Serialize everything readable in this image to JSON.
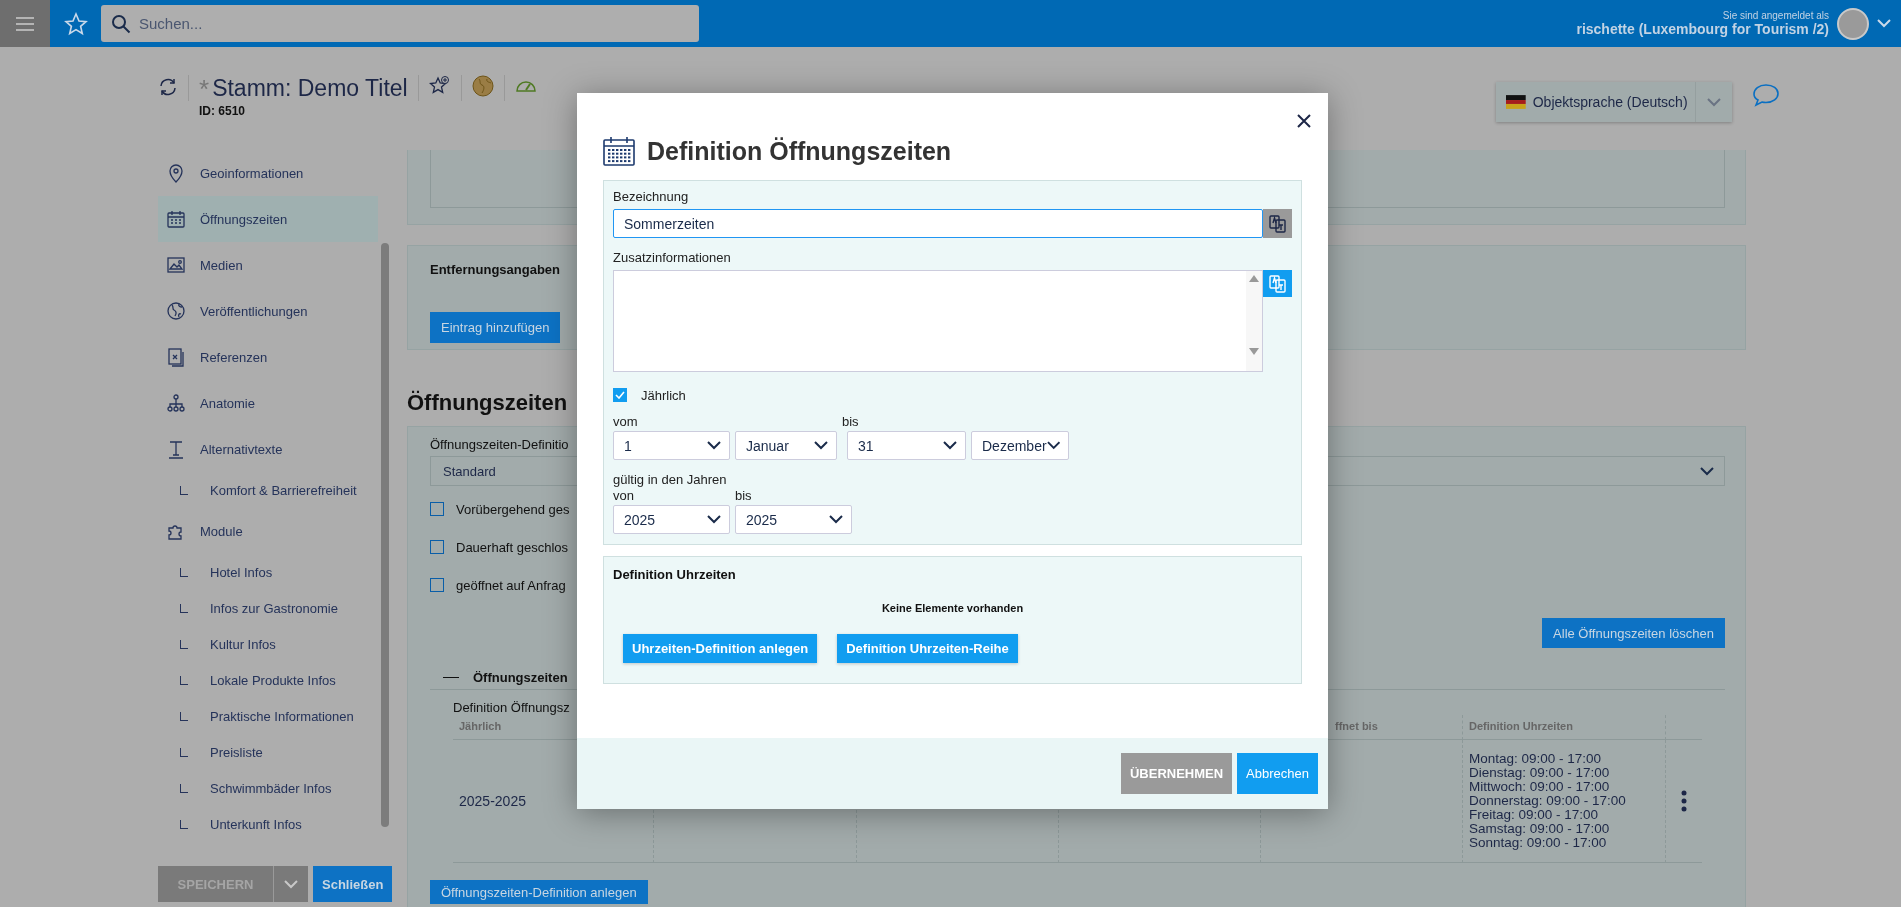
{
  "top_bar": {
    "search": {
      "placeholder": "Suchen..."
    },
    "user": {
      "caption": "Sie sind angemeldet als",
      "name": "rischette (Luxembourg for Tourism /2)"
    }
  },
  "header": {
    "modified_mark": "*",
    "title": "Stamm: Demo Titel",
    "id": "ID: 6510",
    "language": "Objektsprache (Deutsch)"
  },
  "sidebar": {
    "items": [
      {
        "label": "Geoinformationen",
        "selected": false
      },
      {
        "label": "Öffnungszeiten",
        "selected": true
      },
      {
        "label": "Medien",
        "selected": false
      },
      {
        "label": "Veröffentlichungen",
        "selected": false
      },
      {
        "label": "Referenzen",
        "selected": false
      },
      {
        "label": "Anatomie",
        "selected": false
      },
      {
        "label": "Alternativtexte",
        "selected": false,
        "children": [
          {
            "label": "Komfort & Barrierefreiheit",
            "selected": false
          }
        ]
      },
      {
        "label": "Module",
        "selected": false,
        "children": [
          {
            "label": "Hotel Infos",
            "selected": false
          },
          {
            "label": "Infos zur Gastronomie",
            "selected": false
          },
          {
            "label": "Kultur Infos",
            "selected": false
          },
          {
            "label": "Lokale Produkte Infos",
            "selected": false
          },
          {
            "label": "Praktische Informationen",
            "selected": false
          },
          {
            "label": "Preisliste",
            "selected": false
          },
          {
            "label": "Schwimmbäder Infos",
            "selected": false
          },
          {
            "label": "Unterkunft Infos",
            "selected": false
          }
        ]
      }
    ],
    "actions": {
      "save": {
        "label": "SPEICHERN",
        "disabled": true
      },
      "close": {
        "label": "Schließen",
        "disabled": false
      }
    }
  },
  "distances": {
    "title": "Entfernungsangaben",
    "button": "Eintrag hinzufügen"
  },
  "opening_hours": {
    "heading": "Öffnungszeiten",
    "definition_label": "Öffnungszeiten-Definitio",
    "definition_value": "Standard",
    "options": [
      {
        "label": "Vorübergehend ges",
        "checked": false
      },
      {
        "label": "Dauerhaft geschlos",
        "checked": false
      },
      {
        "label": "geöffnet auf Anfrag",
        "checked": false
      }
    ],
    "delete_all": "Alle Öffnungszeiten löschen",
    "group_title": "Öffnungszeiten",
    "table": {
      "title": "Definition Öffnungsz",
      "column_1": "Jährlich",
      "column_5": "ffnet bis",
      "column_6": "Definition Uhrzeiten",
      "rows": [
        {
          "column_1": "2025-2025",
          "column_6": [
            "Montag: 09:00 - 17:00",
            "Dienstag: 09:00 - 17:00",
            "Mittwoch: 09:00 - 17:00",
            "Donnerstag: 09:00 - 17:00",
            "Freitag: 09:00 - 17:00",
            "Samstag: 09:00 - 17:00",
            "Sonntag: 09:00 - 17:00"
          ]
        }
      ]
    },
    "add_button": "Öffnungszeiten-Definition anlegen"
  },
  "dialog": {
    "title": "Definition Öffnungszeiten",
    "form": {
      "name_label": "Bezeichnung",
      "name_value": "Sommerzeiten",
      "info_label": "Zusatzinformationen",
      "yearly": {
        "label": "Jährlich",
        "checked": true
      },
      "from_label": "vom",
      "from_day": "1",
      "from_month": "Januar",
      "to_label": "bis",
      "to_day": "31",
      "to_month": "Dezember",
      "years_label": "gültig in den Jahren",
      "year_from_label": "von",
      "year_from": "2025",
      "year_to_label": "bis",
      "year_to": "2025"
    },
    "times": {
      "title": "Definition Uhrzeiten",
      "empty": "Keine Elemente vorhanden",
      "buttons": [
        "Uhrzeiten-Definition anlegen",
        "Definition Uhrzeiten-Reihe"
      ]
    },
    "buttons": [
      {
        "label": "ÜBERNEHMEN",
        "disabled": true
      },
      {
        "label": "Abbrechen",
        "disabled": false
      }
    ]
  }
}
